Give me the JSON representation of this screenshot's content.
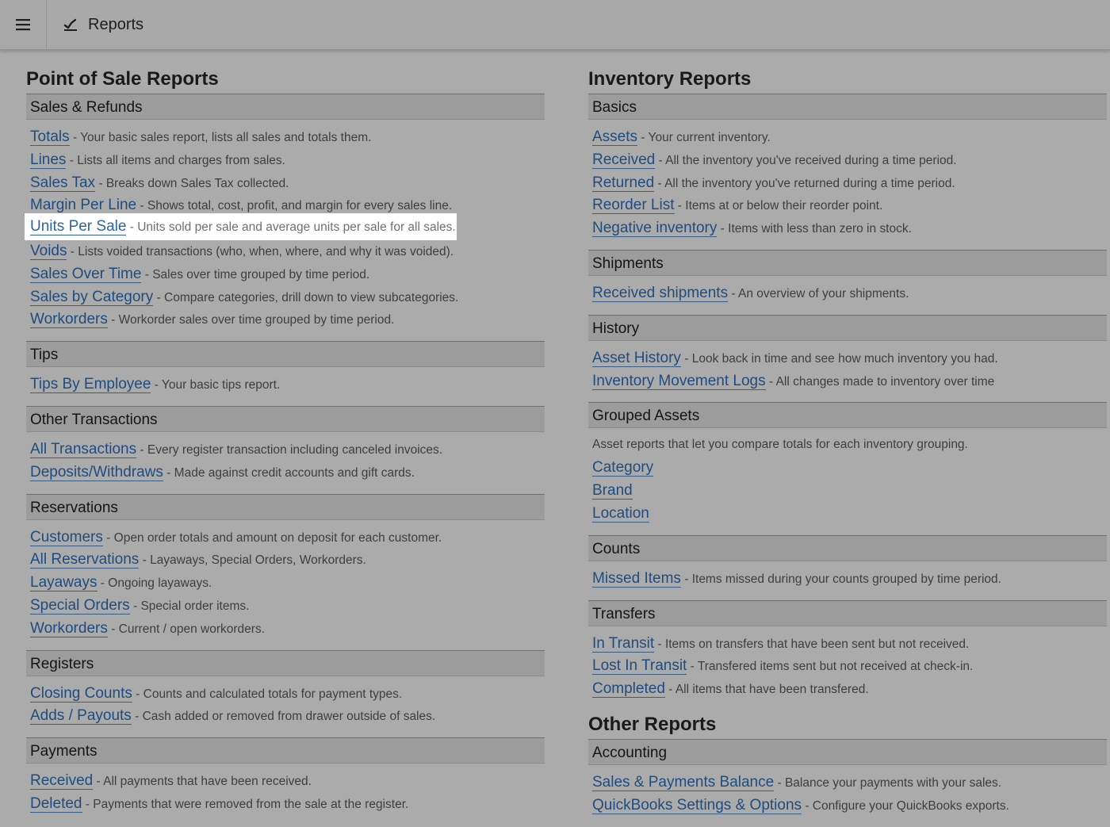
{
  "topbar": {
    "title": "Reports",
    "menu_icon": "hamburger-menu-icon",
    "title_icon": "chart-line-icon"
  },
  "left": {
    "title": "Point of Sale Reports",
    "sections": {
      "sales_refunds": {
        "header": "Sales & Refunds",
        "items": [
          {
            "link": "Totals",
            "desc": "Your basic sales report, lists all sales and totals them."
          },
          {
            "link": "Lines",
            "desc": "Lists all items and charges from sales."
          },
          {
            "link": "Sales Tax",
            "desc": "Breaks down Sales Tax collected."
          },
          {
            "link": "Margin Per Line",
            "desc": "Shows total, cost, profit, and margin for every sales line."
          },
          {
            "link": "Units Per Sale",
            "desc": "Units sold per sale and average units per sale for all sales."
          },
          {
            "link": "Voids",
            "desc": "Lists voided transactions (who, when, where, and why it was voided)."
          },
          {
            "link": "Sales Over Time",
            "desc": "Sales over time grouped by time period."
          },
          {
            "link": "Sales by Category",
            "desc": "Compare categories, drill down to view subcategories."
          },
          {
            "link": "Workorders",
            "desc": "Workorder sales over time grouped by time period."
          }
        ]
      },
      "tips": {
        "header": "Tips",
        "items": [
          {
            "link": "Tips By Employee",
            "desc": "Your basic tips report."
          }
        ]
      },
      "other_transactions": {
        "header": "Other Transactions",
        "items": [
          {
            "link": "All Transactions",
            "desc": "Every register transaction including canceled invoices."
          },
          {
            "link": "Deposits/Withdraws",
            "desc": "Made against credit accounts and gift cards."
          }
        ]
      },
      "reservations": {
        "header": "Reservations",
        "items": [
          {
            "link": "Customers",
            "desc": "Open order totals and amount on deposit for each customer."
          },
          {
            "link": "All Reservations",
            "desc": "Layaways, Special Orders, Workorders."
          },
          {
            "link": "Layaways",
            "desc": "Ongoing layaways."
          },
          {
            "link": "Special Orders",
            "desc": "Special order items."
          },
          {
            "link": "Workorders",
            "desc": "Current / open workorders."
          }
        ]
      },
      "registers": {
        "header": "Registers",
        "items": [
          {
            "link": "Closing Counts",
            "desc": "Counts and calculated totals for payment types."
          },
          {
            "link": "Adds / Payouts",
            "desc": "Cash added or removed from drawer outside of sales."
          }
        ]
      },
      "payments": {
        "header": "Payments",
        "items": [
          {
            "link": "Received",
            "desc": "All payments that have been received."
          },
          {
            "link": "Deleted",
            "desc": "Payments that were removed from the sale at the register."
          }
        ]
      }
    }
  },
  "right": {
    "title": "Inventory Reports",
    "sections": {
      "basics": {
        "header": "Basics",
        "items": [
          {
            "link": "Assets",
            "desc": "Your current inventory."
          },
          {
            "link": "Received",
            "desc": "All the inventory you've received during a time period."
          },
          {
            "link": "Returned",
            "desc": "All the inventory you've returned during a time period."
          },
          {
            "link": "Reorder List",
            "desc": "Items at or below their reorder point."
          },
          {
            "link": "Negative inventory",
            "desc": "Items with less than zero in stock."
          }
        ]
      },
      "shipments": {
        "header": "Shipments",
        "items": [
          {
            "link": "Received shipments",
            "desc": "An overview of your shipments."
          }
        ]
      },
      "history": {
        "header": "History",
        "items": [
          {
            "link": "Asset History",
            "desc": "Look back in time and see how much inventory you had."
          },
          {
            "link": "Inventory Movement Logs",
            "desc": "All changes made to inventory over time"
          }
        ]
      },
      "grouped_assets": {
        "header": "Grouped Assets",
        "note": "Asset reports that let you compare totals for each inventory grouping.",
        "links": [
          "Category",
          "Brand",
          "Location"
        ]
      },
      "counts": {
        "header": "Counts",
        "items": [
          {
            "link": "Missed Items",
            "desc": "Items missed during your counts grouped by time period."
          }
        ]
      },
      "transfers": {
        "header": "Transfers",
        "items": [
          {
            "link": "In Transit",
            "desc": "Items on transfers that have been sent but not received."
          },
          {
            "link": "Lost In Transit",
            "desc": "Transfered items sent but not received at check-in."
          },
          {
            "link": "Completed",
            "desc": "All items that have been transfered."
          }
        ]
      }
    }
  },
  "other": {
    "title": "Other Reports",
    "sections": {
      "accounting": {
        "header": "Accounting",
        "items": [
          {
            "link": "Sales & Payments Balance",
            "desc": "Balance your payments with your sales."
          },
          {
            "link": "QuickBooks Settings & Options",
            "desc": "Configure your QuickBooks exports."
          }
        ]
      }
    }
  },
  "highlighted": {
    "section": "left.sections.sales_refunds",
    "index": 4
  }
}
